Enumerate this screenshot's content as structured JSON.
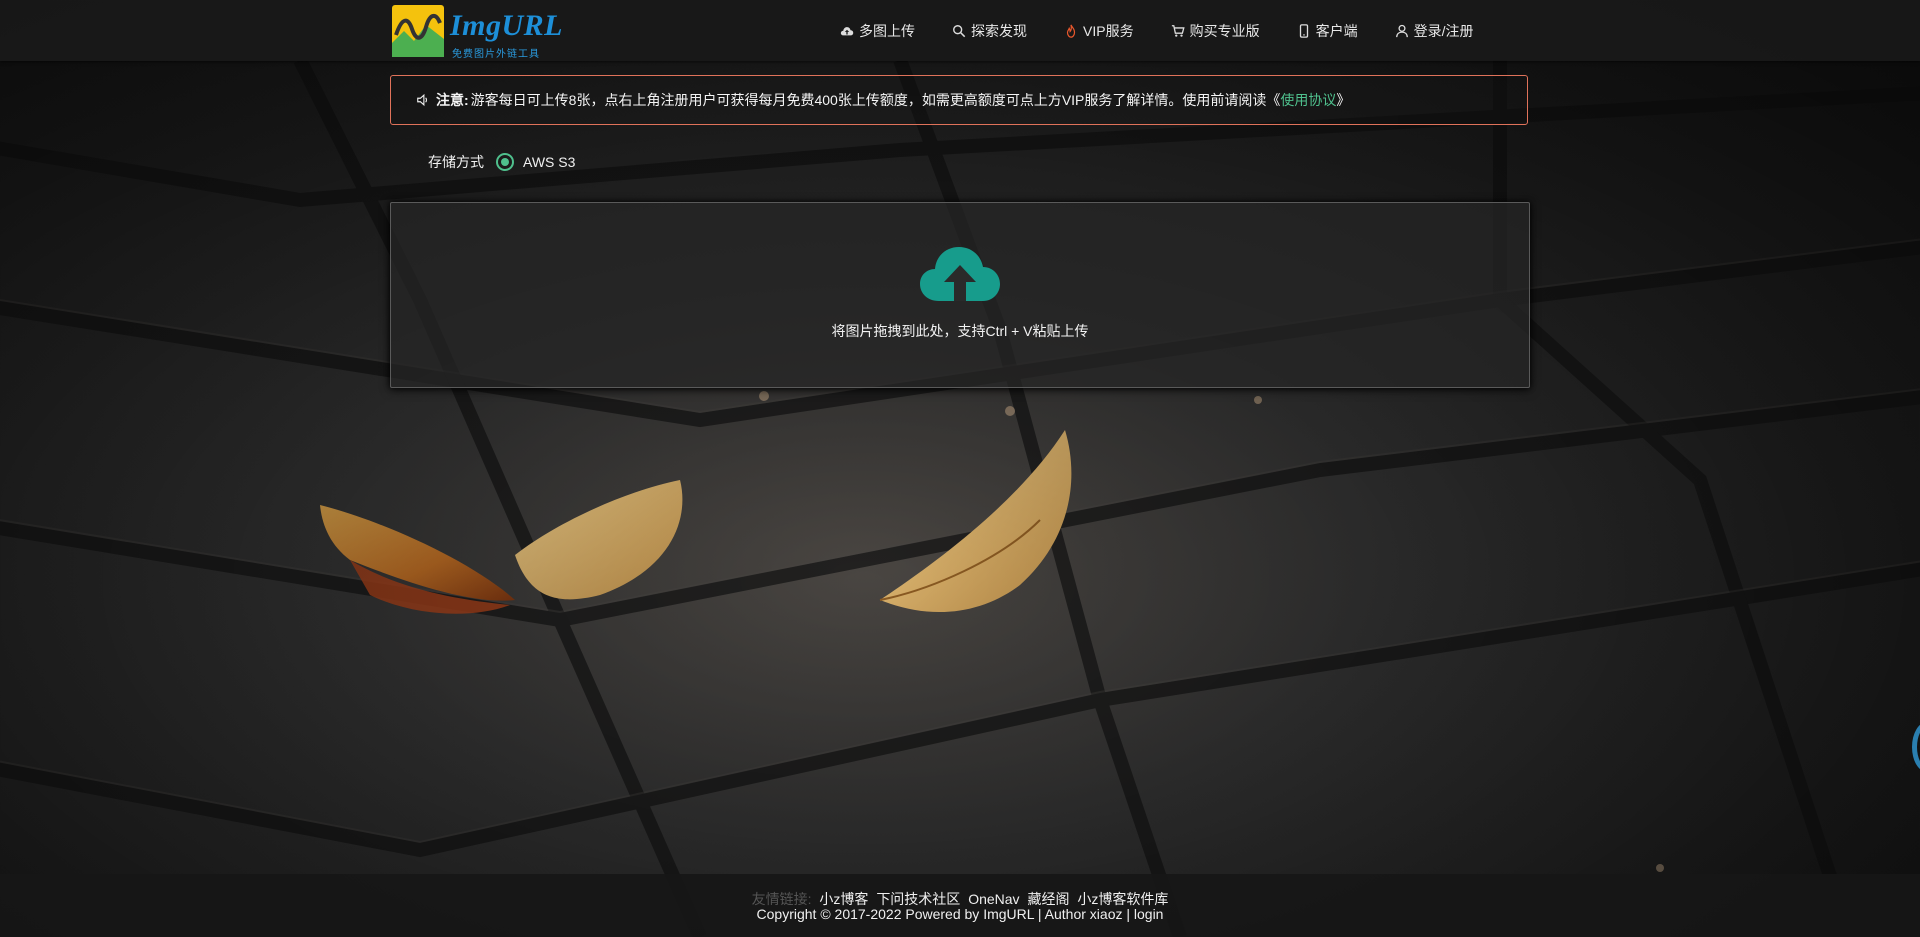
{
  "header": {
    "logo_text": "ImgURL",
    "logo_subtitle": "免费图片外链工具",
    "nav": [
      {
        "label": "多图上传",
        "icon": "cloud-upload-icon"
      },
      {
        "label": "探索发现",
        "icon": "search-icon"
      },
      {
        "label": "VIP服务",
        "icon": "fire-icon"
      },
      {
        "label": "购买专业版",
        "icon": "cart-icon"
      },
      {
        "label": "客户端",
        "icon": "mobile-icon"
      },
      {
        "label": "登录/注册",
        "icon": "user-icon"
      }
    ]
  },
  "notice": {
    "icon": "speaker-icon",
    "prefix": "注意:",
    "text": "游客每日可上传8张，点右上角注册用户可获得每月免费400张上传额度，如需更高额度可点上方VIP服务了解详情。使用前请阅读《",
    "link": "使用协议",
    "suffix": "》",
    "link_color": "#4fc08d",
    "border_color": "#e0725a"
  },
  "storage": {
    "label": "存储方式",
    "selected_option": "AWS S3",
    "accent": "#4fc08d"
  },
  "upload": {
    "icon": "cloud-upload-icon",
    "hint": "将图片拖拽到此处，支持Ctrl + V粘贴上传",
    "icon_color": "#179c8c"
  },
  "footer": {
    "links_label": "友情链接:",
    "links": [
      "小z博客",
      "下问技术社区",
      "OneNav",
      "藏经阁",
      "小z博客软件库"
    ],
    "copyright": "Copyright © 2017-2022 Powered by ImgURL | Author xiaoz | login"
  }
}
